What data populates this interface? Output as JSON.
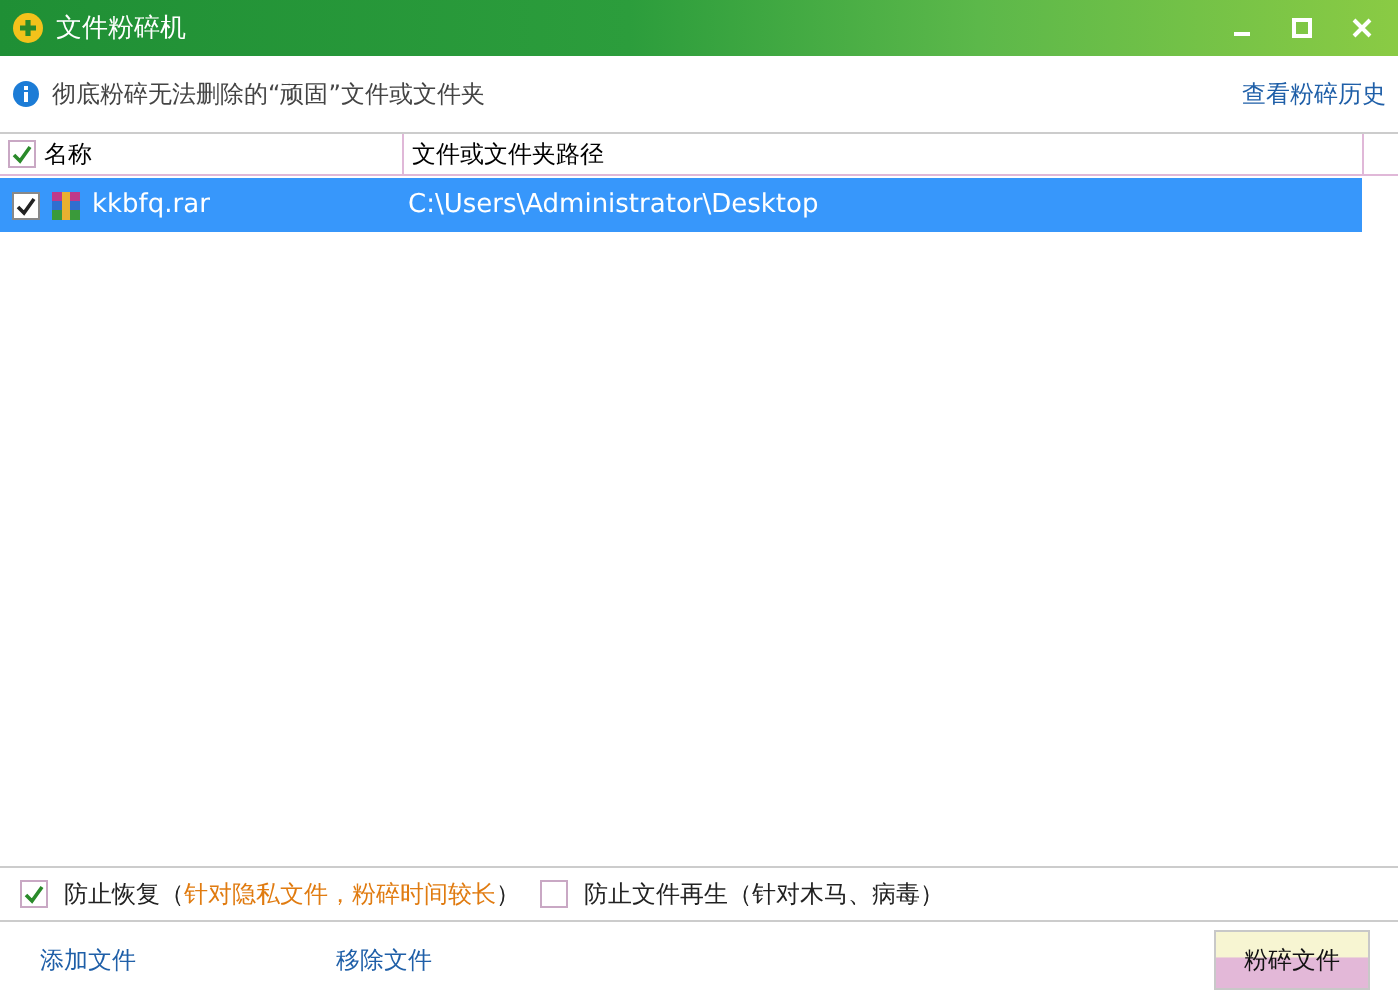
{
  "window": {
    "title": "文件粉碎机"
  },
  "info": {
    "text": "彻底粉碎无法删除的“顽固”文件或文件夹",
    "link": "查看粉碎历史"
  },
  "table": {
    "all_checked": true,
    "columns": [
      "名称",
      "文件或文件夹路径"
    ],
    "rows": [
      {
        "name": "kkbfq.rar",
        "path": "C:\\Users\\Administrator\\Desktop",
        "checked": true,
        "selected": true
      }
    ]
  },
  "options": [
    {
      "label": "防止恢复（",
      "note": "针对隐私文件，粉碎时间较长",
      "label_end": "）",
      "checked": true
    },
    {
      "label": "防止文件再生（针对木马、病毒）",
      "checked": false
    }
  ],
  "links": [
    "添加文件",
    "移除文件"
  ],
  "button": "粉碎文件"
}
